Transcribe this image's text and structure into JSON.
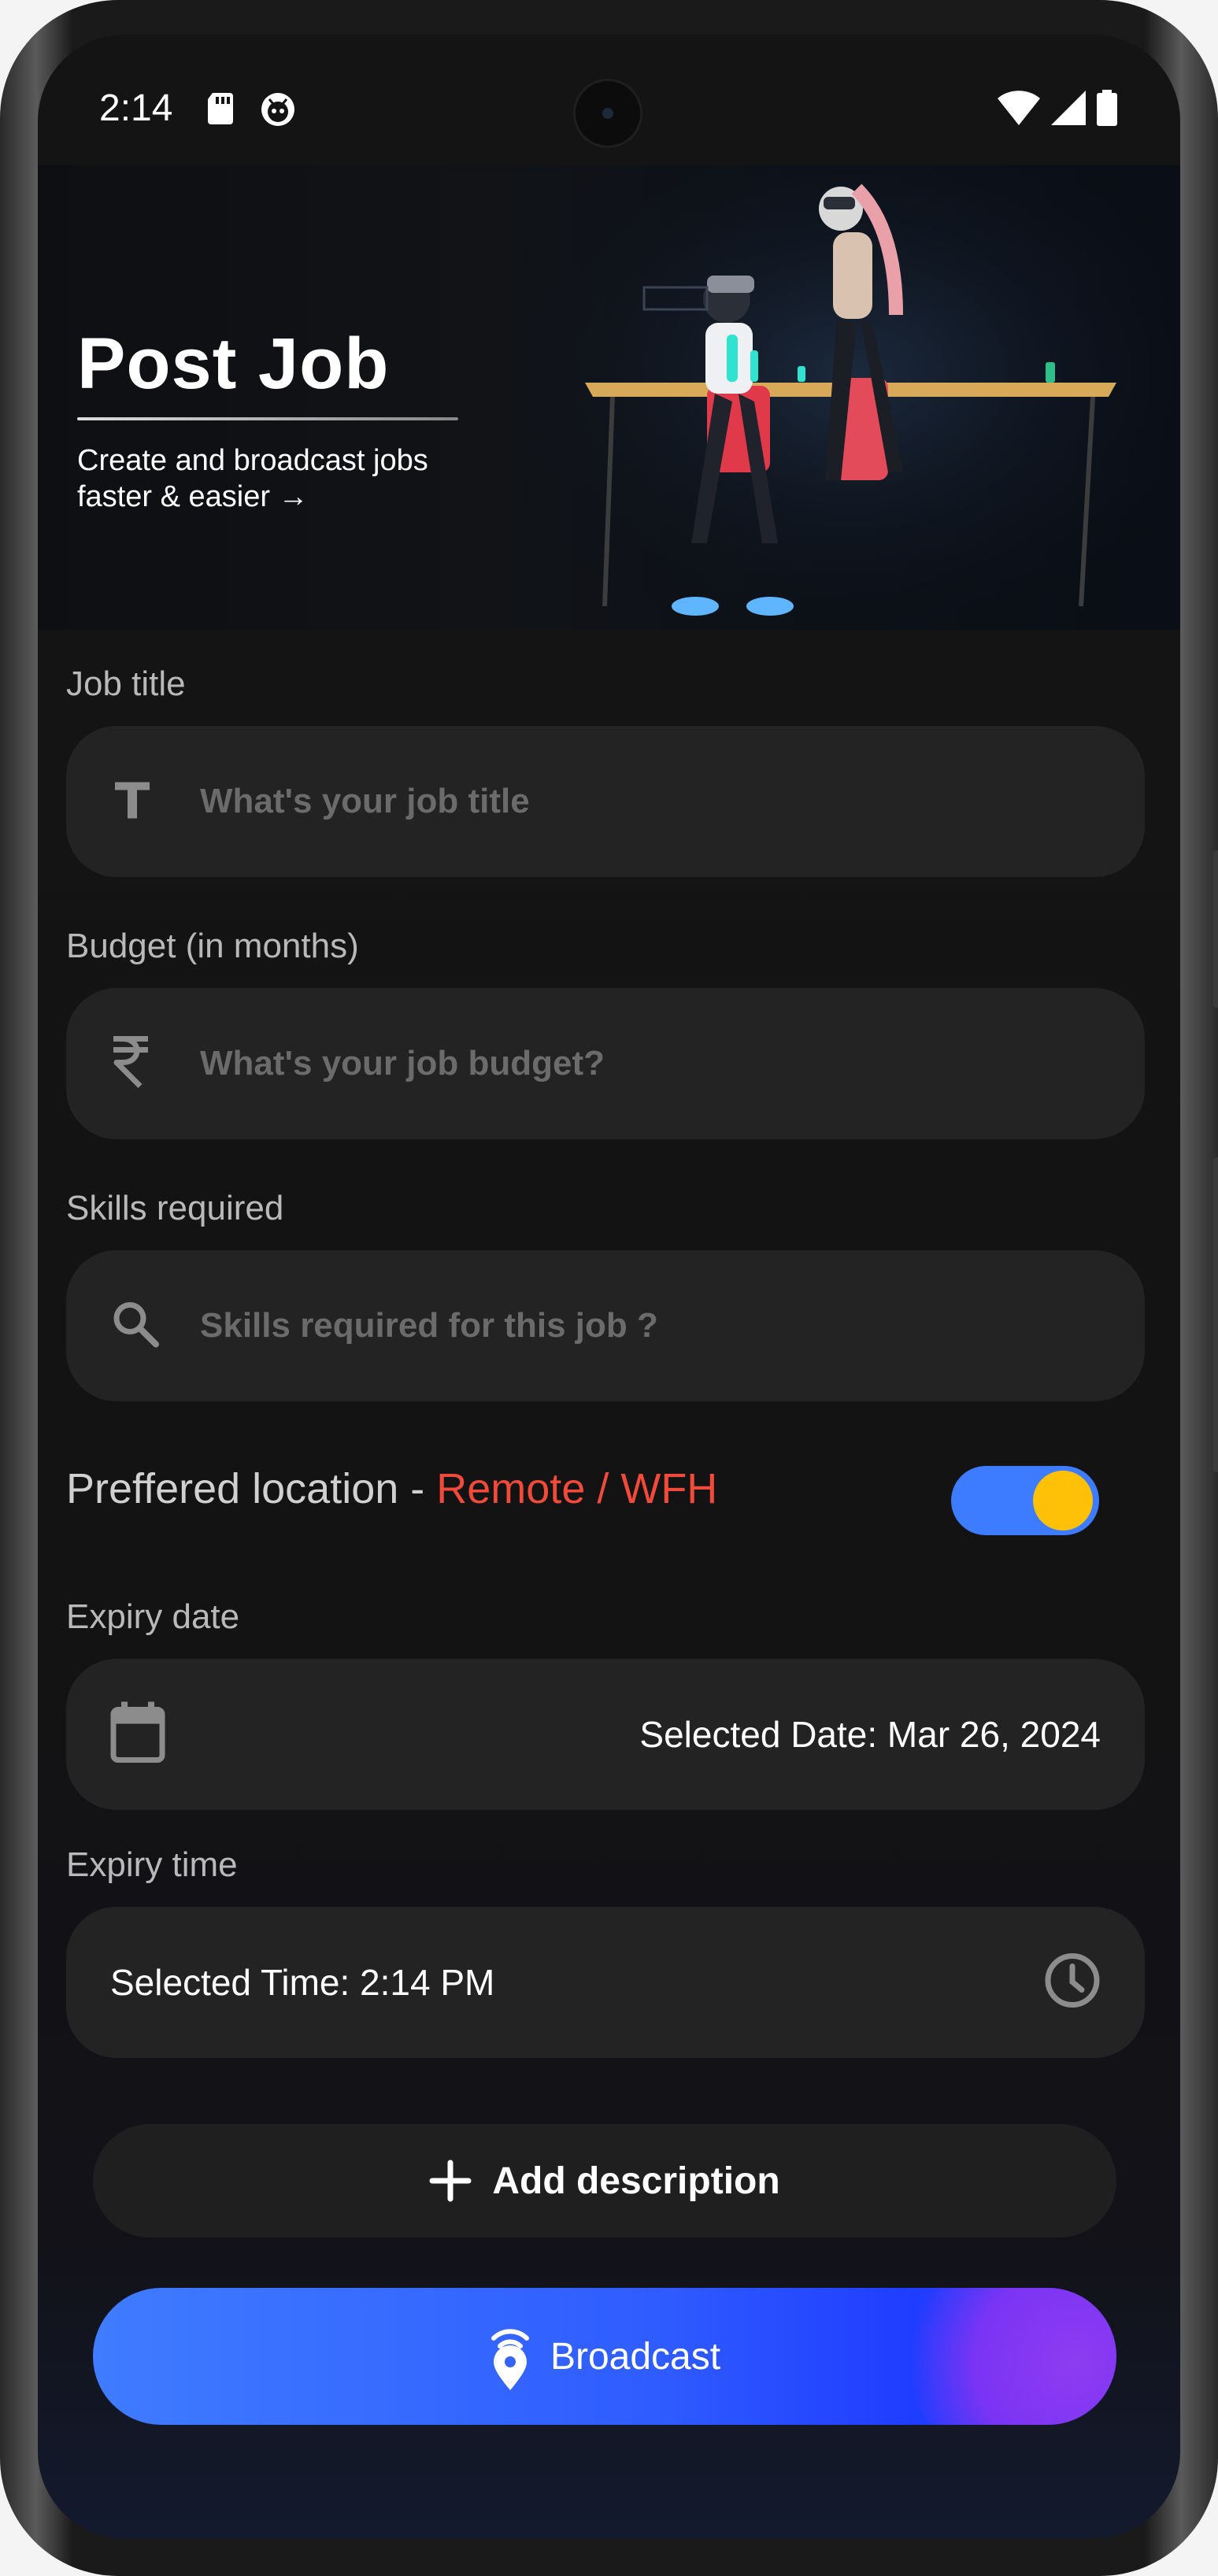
{
  "status_bar": {
    "time": "2:14"
  },
  "hero": {
    "title": "Post Job",
    "subtitle": "Create and broadcast jobs faster & easier →"
  },
  "form": {
    "job_title": {
      "label": "Job title",
      "placeholder": "What's your job title",
      "icon": "text-format-icon"
    },
    "budget": {
      "label": "Budget (in months)",
      "placeholder": "What's your job budget?",
      "icon": "rupee-icon"
    },
    "skills": {
      "label": "Skills required",
      "placeholder": "Skills required for this job ?",
      "icon": "search-icon"
    },
    "preferred_location": {
      "label": "Preffered location - ",
      "value": "Remote / WFH",
      "toggle_on": true
    },
    "expiry_date": {
      "label": "Expiry date",
      "value": "Selected Date: Mar 26, 2024",
      "icon": "calendar-icon"
    },
    "expiry_time": {
      "label": "Expiry time",
      "value": "Selected Time: 2:14 PM",
      "icon": "clock-icon"
    }
  },
  "actions": {
    "add_description": "Add description",
    "broadcast": "Broadcast"
  },
  "colors": {
    "accent_red": "#f04a3a",
    "toggle_track": "#3d7cff",
    "toggle_knob": "#ffc107",
    "broadcast_gradient_start": "#3f7cff",
    "broadcast_gradient_end": "#7a34f4"
  }
}
